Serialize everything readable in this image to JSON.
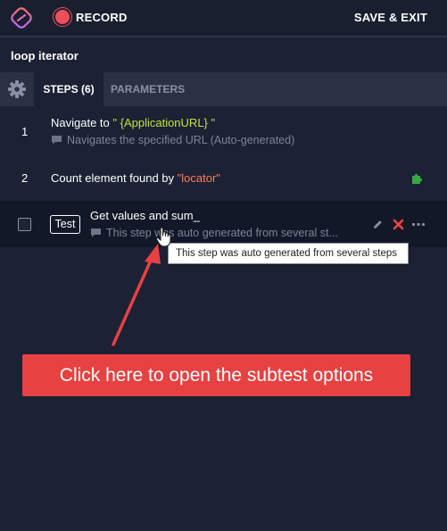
{
  "toolbar": {
    "record_label": "RECORD",
    "save_exit_label": "SAVE & EXIT"
  },
  "test": {
    "name": "loop iterator"
  },
  "tabs": {
    "steps_label": "STEPS (6)",
    "parameters_label": "PARAMETERS"
  },
  "steps": [
    {
      "number": "1",
      "text_prefix": "Navigate to ",
      "param": "\" {ApplicationURL} \"",
      "description": "Navigates the specified URL (Auto-generated)"
    },
    {
      "number": "2",
      "text_prefix": "Count element found by ",
      "locator": "\"locator\""
    },
    {
      "badge": "Test",
      "title": "Get values and sum_",
      "description": "This step was auto generated from several st..."
    }
  ],
  "tooltip": {
    "text": "This step was auto generated from several steps"
  },
  "annotation": {
    "callout_text": "Click here to open the subtest options"
  },
  "colors": {
    "background": "#1c2133",
    "record_red": "#ee4f58",
    "param_green": "#c5e23b",
    "locator_orange": "#ff7d5e",
    "delete_red": "#ee4444",
    "plugin_green": "#33aa44",
    "callout_red": "#e74142"
  },
  "icons": [
    "logo-icon",
    "record-icon",
    "gear-icon",
    "comment-icon",
    "puzzle-icon",
    "pencil-icon",
    "delete-icon",
    "more-icon",
    "hand-cursor-icon"
  ]
}
